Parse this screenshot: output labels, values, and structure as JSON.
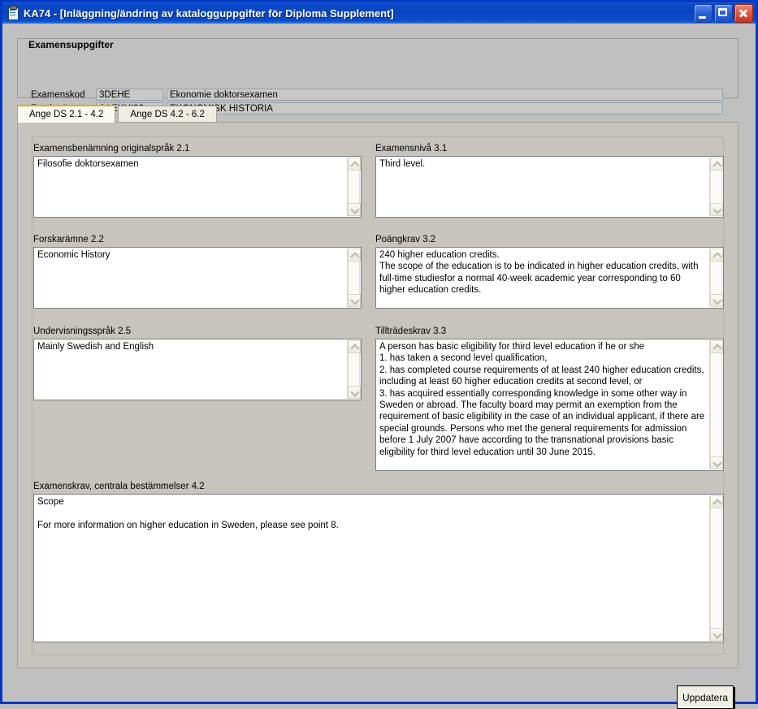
{
  "window": {
    "title": "KA74 - [Inläggning/ändring av katalogguppgifter för Diploma Supplement]",
    "icon": "document-clipboard-icon",
    "minimize_label": "Minimera",
    "maximize_label": "Maximera",
    "close_label": "Stäng"
  },
  "group": {
    "title": "Examensuppgifter",
    "rows": [
      {
        "label": "Examenskod",
        "code": "3DEHE",
        "name": "Ekonomie doktorsexamen"
      },
      {
        "label": "Forskarämne",
        "code": "SAEKHI00",
        "name": "EKONOMISK HISTORIA"
      }
    ]
  },
  "tabs": [
    {
      "label": "Ange DS 2.1 - 4.2",
      "active": true
    },
    {
      "label": "Ange DS 4.2 - 6.2",
      "active": false
    }
  ],
  "fields": {
    "examensbenamning": {
      "label": "Examensbenämning originalspråk  2.1",
      "value": "Filosofie doktorsexamen"
    },
    "forskaramne": {
      "label": "Forskarämne  2.2",
      "value": "Economic History"
    },
    "undervisningssprak": {
      "label": "Undervisningsspråk  2.5",
      "value": "Mainly Swedish and English"
    },
    "examensniva": {
      "label": "Examensnivå  3.1",
      "value": "Third level."
    },
    "poangkrav": {
      "label": "Poängkrav  3.2",
      "value": "240 higher education credits.\nThe scope of the education is to be indicated in higher education credits, with full-time studiesfor a normal 40-week academic year corresponding to 60 higher education credits."
    },
    "tilltradeskrav": {
      "label": "Tillträdeskrav  3.3",
      "value": "A person has basic eligibility for third level education if he or she\n1. has taken a second level qualification,\n2. has completed course requirements of at least 240 higher education credits, including at least 60 higher education credits at second level, or\n3. has acquired essentially corresponding knowledge in some other way in Sweden or abroad. The faculty board may permit an exemption from the requirement of basic eligibility in the case of an individual applicant, if there are special grounds. Persons who met the general requirements for admission before 1 July 2007 have according to the transnational provisions basic eligibility for third level education until 30 June 2015."
    },
    "examenskrav": {
      "label": "Examenskrav, centrala bestämmelser  4.2",
      "value": "Scope\n\nFor more information on higher education in Sweden, please see point 8."
    }
  },
  "buttons": {
    "update": "Uppdatera"
  },
  "colors": {
    "titlebar_blue": "#0845c3",
    "window_frame": "#0437c4",
    "client_bg": "#c0c0c0",
    "tab_active_bg": "#faf9f4",
    "tab_accent": "#f0a500",
    "field_bg": "#c8c8c4",
    "textarea_bg": "#ffffff"
  }
}
